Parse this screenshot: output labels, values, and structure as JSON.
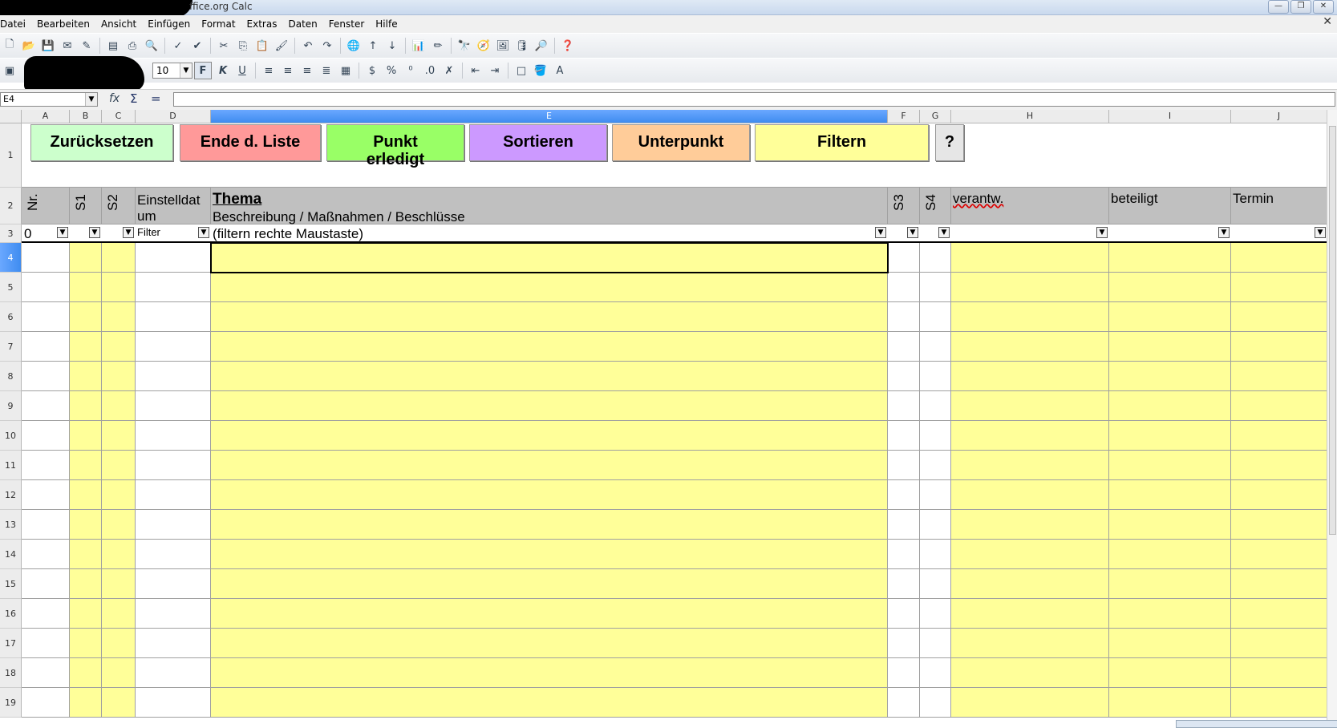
{
  "window": {
    "title": "ffice.org Calc",
    "buttons": [
      "—",
      "❐",
      "✕"
    ]
  },
  "menu": [
    "Datei",
    "Bearbeiten",
    "Ansicht",
    "Einfügen",
    "Format",
    "Extras",
    "Daten",
    "Fenster",
    "Hilfe"
  ],
  "toolbar": {
    "font_size": "10",
    "bold": "F",
    "italic": "K",
    "underline": "U"
  },
  "formula_bar": {
    "cell_ref": "E4",
    "fx": "fx",
    "sum": "Σ",
    "eq": "=",
    "value": ""
  },
  "columns": [
    "A",
    "B",
    "C",
    "D",
    "E",
    "F",
    "G",
    "H",
    "I",
    "J"
  ],
  "rows": [
    "1",
    "2",
    "3",
    "4",
    "5",
    "6",
    "7",
    "8",
    "9",
    "10",
    "11",
    "12",
    "13",
    "14",
    "15",
    "16",
    "17",
    "18",
    "19"
  ],
  "buttons": [
    {
      "label": "Zurücksetzen",
      "color": "#ccffcc"
    },
    {
      "label": "Ende d. Liste",
      "color": "#ff9999"
    },
    {
      "label": "Punkt erledigt",
      "color": "#99ff66"
    },
    {
      "label": "Sortieren",
      "color": "#cc99ff"
    },
    {
      "label": "Unterpunkt",
      "color": "#ffcc99"
    },
    {
      "label": "Filtern",
      "color": "#ffff99"
    },
    {
      "label": "?",
      "color": "#e6e6e6"
    }
  ],
  "header_row": {
    "nr": "Nr.",
    "s1": "S1",
    "s2": "S2",
    "einstelldatum_1": "Einstelldat",
    "einstelldatum_2": "um",
    "thema": "Thema",
    "beschreibung": "Beschreibung / Maßnahmen / Beschlüsse",
    "s3": "S3",
    "s4": "S4",
    "verantw": "verantw.",
    "beteiligt": "beteiligt",
    "termin": "Termin"
  },
  "filter_row": {
    "a": "0",
    "d": "Filter",
    "e": "(filtern rechte Maustaste)"
  },
  "colors": {
    "yellow_cell": "#ffff99",
    "header_gray": "#c0c0c0",
    "selection": "#3f8cf0"
  }
}
